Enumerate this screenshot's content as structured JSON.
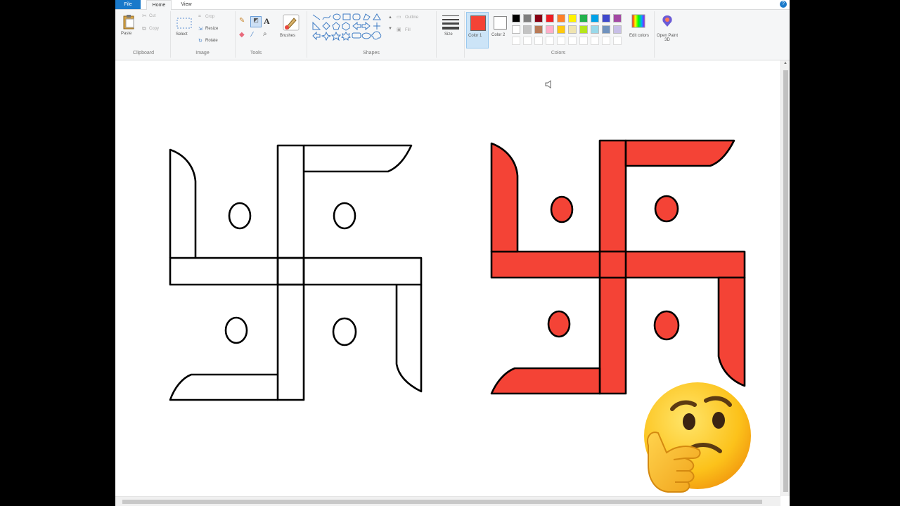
{
  "tabs": {
    "file": "File",
    "home": "Home",
    "view": "View"
  },
  "clipboard": {
    "paste": "Paste",
    "cut": "Cut",
    "copy": "Copy",
    "group_label": "Clipboard"
  },
  "image": {
    "select": "Select",
    "crop": "Crop",
    "resize": "Resize",
    "rotate": "Rotate",
    "group_label": "Image"
  },
  "tools": {
    "group_label": "Tools"
  },
  "brushes": {
    "label": "Brushes"
  },
  "shapes": {
    "outline": "Outline",
    "fill": "Fill",
    "group_label": "Shapes"
  },
  "size": {
    "label": "Size"
  },
  "colors": {
    "color1_label": "Color 1",
    "color2_label": "Color 2",
    "edit_colors": "Edit colors",
    "open_paint3d": "Open Paint 3D",
    "group_label": "Colors",
    "color1_value": "#f44336",
    "color2_value": "#ffffff",
    "palette_row1": [
      "#000000",
      "#7f7f7f",
      "#880015",
      "#ed1c24",
      "#ff7f27",
      "#fff200",
      "#22b14c",
      "#00a2e8",
      "#3f48cc",
      "#a349a4"
    ],
    "palette_row2": [
      "#ffffff",
      "#c3c3c3",
      "#b97a57",
      "#ffaec9",
      "#ffc90e",
      "#efe4b0",
      "#b5e61d",
      "#99d9ea",
      "#7092be",
      "#c8bfe7"
    ]
  },
  "drawing": {
    "fill_color": "#f44336",
    "outline_color": "#000000"
  },
  "overlay": {
    "emoji": "thinking-face"
  }
}
